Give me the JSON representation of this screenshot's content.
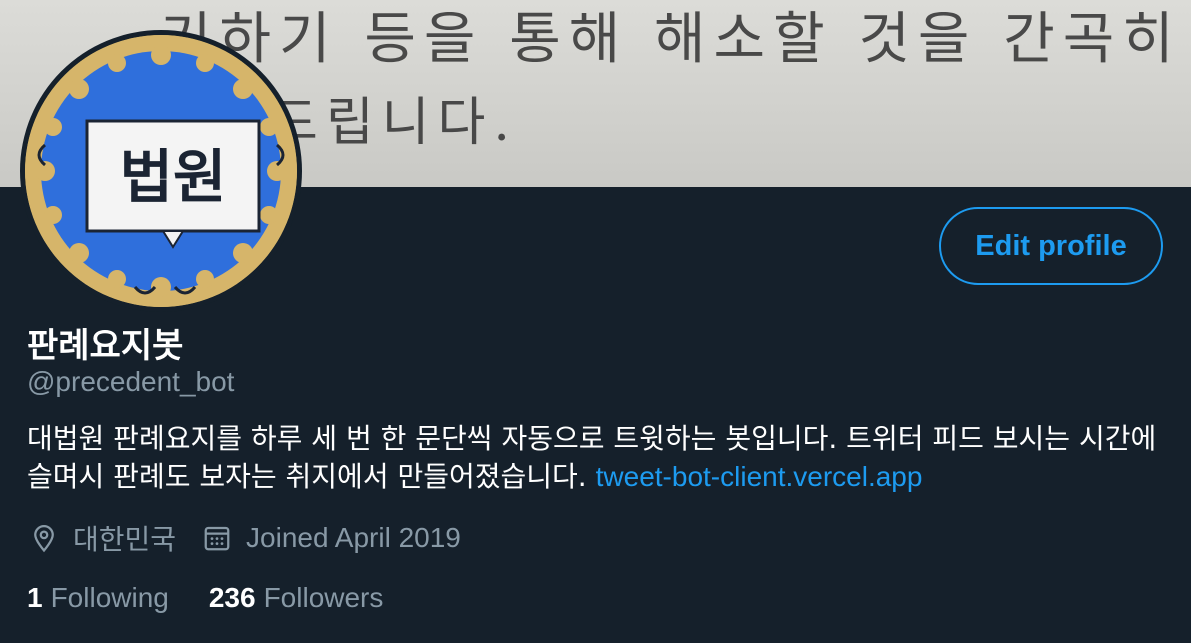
{
  "banner": {
    "line1": "기하기 등을 통해 해소할 것을 간곡히",
    "line2": "드립니다."
  },
  "avatar": {
    "text": "법원",
    "colors": {
      "ring": "#d6b56a",
      "field": "#2f6fdc",
      "plate": "#f4f4f4",
      "text": "#1b2433"
    }
  },
  "profile": {
    "edit_label": "Edit profile",
    "display_name": "판례요지봇",
    "handle": "@precedent_bot",
    "bio_line1": "대법원 판례요지를 하루 세 번 한 문단씩 자동으로 트윗하는 봇입니다. 트위터 피드 보시는 시간에",
    "bio_line2": "슬며시 판례도 보자는 취지에서 만들어졌습니다.",
    "bio_link": "tweet-bot-client.vercel.app",
    "location": "대한민국",
    "location_icon": "location-pin-icon",
    "joined": "Joined April 2019",
    "joined_icon": "calendar-icon"
  },
  "stats": {
    "following_count": "1",
    "following_label": "Following",
    "followers_count": "236",
    "followers_label": "Followers"
  },
  "colors": {
    "background": "#15202b",
    "accent": "#1d9bf0",
    "secondary_text": "#8899a6"
  }
}
